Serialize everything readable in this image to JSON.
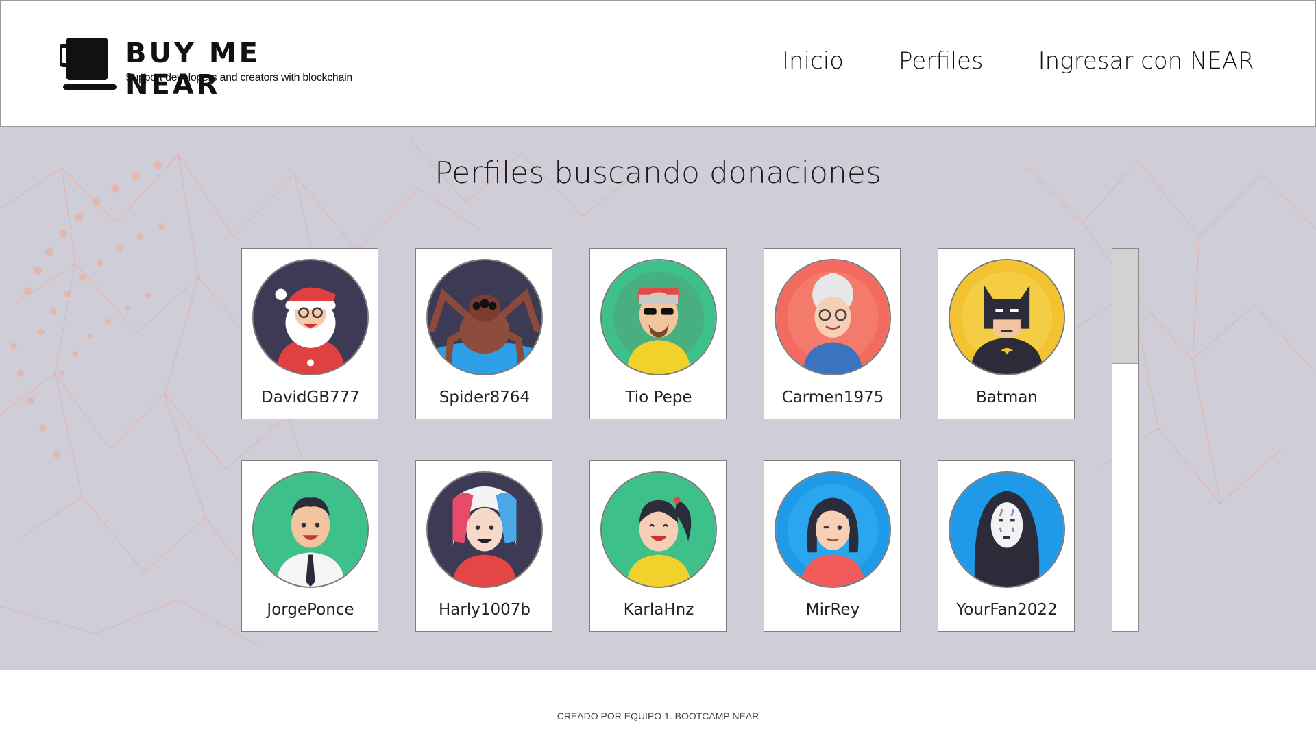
{
  "brand": {
    "name": "BUY ME NEAR",
    "tagline": "Support developers and creators with blockchain",
    "icon": "coffee-cup-icon"
  },
  "nav": {
    "items": [
      {
        "label": "Inicio"
      },
      {
        "label": "Perfiles"
      },
      {
        "label": "Ingresar con NEAR"
      }
    ]
  },
  "main": {
    "title": "Perfiles buscando donaciones",
    "profiles": [
      {
        "name": "DavidGB777",
        "avatar": "santa-avatar"
      },
      {
        "name": "Spider8764",
        "avatar": "spider-avatar"
      },
      {
        "name": "Tio Pepe",
        "avatar": "heisenberg-avatar"
      },
      {
        "name": "Carmen1975",
        "avatar": "grandma-avatar"
      },
      {
        "name": "Batman",
        "avatar": "batman-avatar"
      },
      {
        "name": "JorgePonce",
        "avatar": "businessman-avatar"
      },
      {
        "name": "Harly1007b",
        "avatar": "harley-avatar"
      },
      {
        "name": "KarlaHnz",
        "avatar": "girl-ponytail-avatar"
      },
      {
        "name": "MirRey",
        "avatar": "winking-girl-avatar"
      },
      {
        "name": "YourFan2022",
        "avatar": "no-face-avatar"
      }
    ]
  },
  "footer": {
    "text": "CREADO POR EQUIPO 1. BOOTCAMP NEAR"
  },
  "colors": {
    "hero_bg": "#cfced8",
    "network_lines": "#f0a48c",
    "card_border": "#7f7f7f"
  }
}
